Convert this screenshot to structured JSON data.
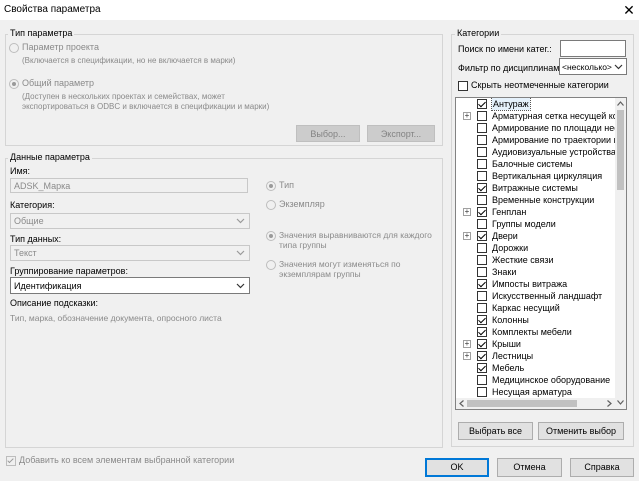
{
  "window": {
    "title": "Свойства параметра",
    "close_icon": "close-icon"
  },
  "param_type": {
    "title": "Тип параметра",
    "project_label": "Параметр проекта",
    "project_desc": "(Включается в спецификации, но не включается в марки)",
    "shared_label": "Общий параметр",
    "shared_desc": "(Доступен в нескольких проектах и семействах, может экспортироваться в ODBC и включается в спецификации и марки)",
    "select_btn": "Выбор...",
    "export_btn": "Экспорт..."
  },
  "param_data": {
    "title": "Данные параметра",
    "name_label": "Имя:",
    "name_value": "ADSK_Марка",
    "discipline_label": "Категория:",
    "discipline_value": "Общие",
    "datatype_label": "Тип данных:",
    "datatype_value": "Текст",
    "grouping_label": "Группирование параметров:",
    "grouping_value": "Идентификация",
    "tooltip_label": "Описание подсказки:",
    "tooltip_value": "Тип, марка, обозначение документа, опросного листа",
    "type_label": "Тип",
    "instance_label": "Экземпляр",
    "aligned_label": "Значения выравниваются для каждого типа группы",
    "vary_label": "Значения могут изменяться по экземплярам группы"
  },
  "add_all_label": "Добавить ко всем элементам выбранной категории",
  "categories": {
    "title": "Категории",
    "search_label": "Поиск по имени катег.:",
    "search_value": "",
    "filter_label": "Фильтр по дисциплинам:",
    "filter_value": "<несколько>",
    "hide_unchecked_label": "Скрыть неотмеченные категории",
    "items": [
      {
        "label": "Антураж",
        "checked": true,
        "expandable": false,
        "selected": true
      },
      {
        "label": "Арматурная сетка несущей конструкции",
        "checked": false,
        "expandable": true
      },
      {
        "label": "Армирование по площади несущей конструкции",
        "checked": false,
        "expandable": false
      },
      {
        "label": "Армирование по траектории несущей конструкции",
        "checked": false,
        "expandable": false
      },
      {
        "label": "Аудиовизуальные устройства",
        "checked": false,
        "expandable": false
      },
      {
        "label": "Балочные системы",
        "checked": false,
        "expandable": false
      },
      {
        "label": "Вертикальная циркуляция",
        "checked": false,
        "expandable": false
      },
      {
        "label": "Витражные системы",
        "checked": true,
        "expandable": false
      },
      {
        "label": "Временные конструкции",
        "checked": false,
        "expandable": false
      },
      {
        "label": "Генплан",
        "checked": true,
        "expandable": true
      },
      {
        "label": "Группы модели",
        "checked": false,
        "expandable": false
      },
      {
        "label": "Двери",
        "checked": true,
        "expandable": true
      },
      {
        "label": "Дорожки",
        "checked": false,
        "expandable": false
      },
      {
        "label": "Жесткие связи",
        "checked": false,
        "expandable": false
      },
      {
        "label": "Знаки",
        "checked": false,
        "expandable": false
      },
      {
        "label": "Импосты витража",
        "checked": true,
        "expandable": false
      },
      {
        "label": "Искусственный ландшафт",
        "checked": false,
        "expandable": false
      },
      {
        "label": "Каркас несущий",
        "checked": false,
        "expandable": false
      },
      {
        "label": "Колонны",
        "checked": true,
        "expandable": false
      },
      {
        "label": "Комплекты мебели",
        "checked": true,
        "expandable": false
      },
      {
        "label": "Крыши",
        "checked": true,
        "expandable": true
      },
      {
        "label": "Лестницы",
        "checked": true,
        "expandable": true
      },
      {
        "label": "Мебель",
        "checked": true,
        "expandable": false
      },
      {
        "label": "Медицинское оборудование",
        "checked": false,
        "expandable": false
      },
      {
        "label": "Несущая арматура",
        "checked": false,
        "expandable": false
      }
    ],
    "select_all_btn": "Выбрать все",
    "deselect_all_btn": "Отменить выбор"
  },
  "footer": {
    "ok": "OK",
    "cancel": "Отмена",
    "help": "Справка"
  }
}
